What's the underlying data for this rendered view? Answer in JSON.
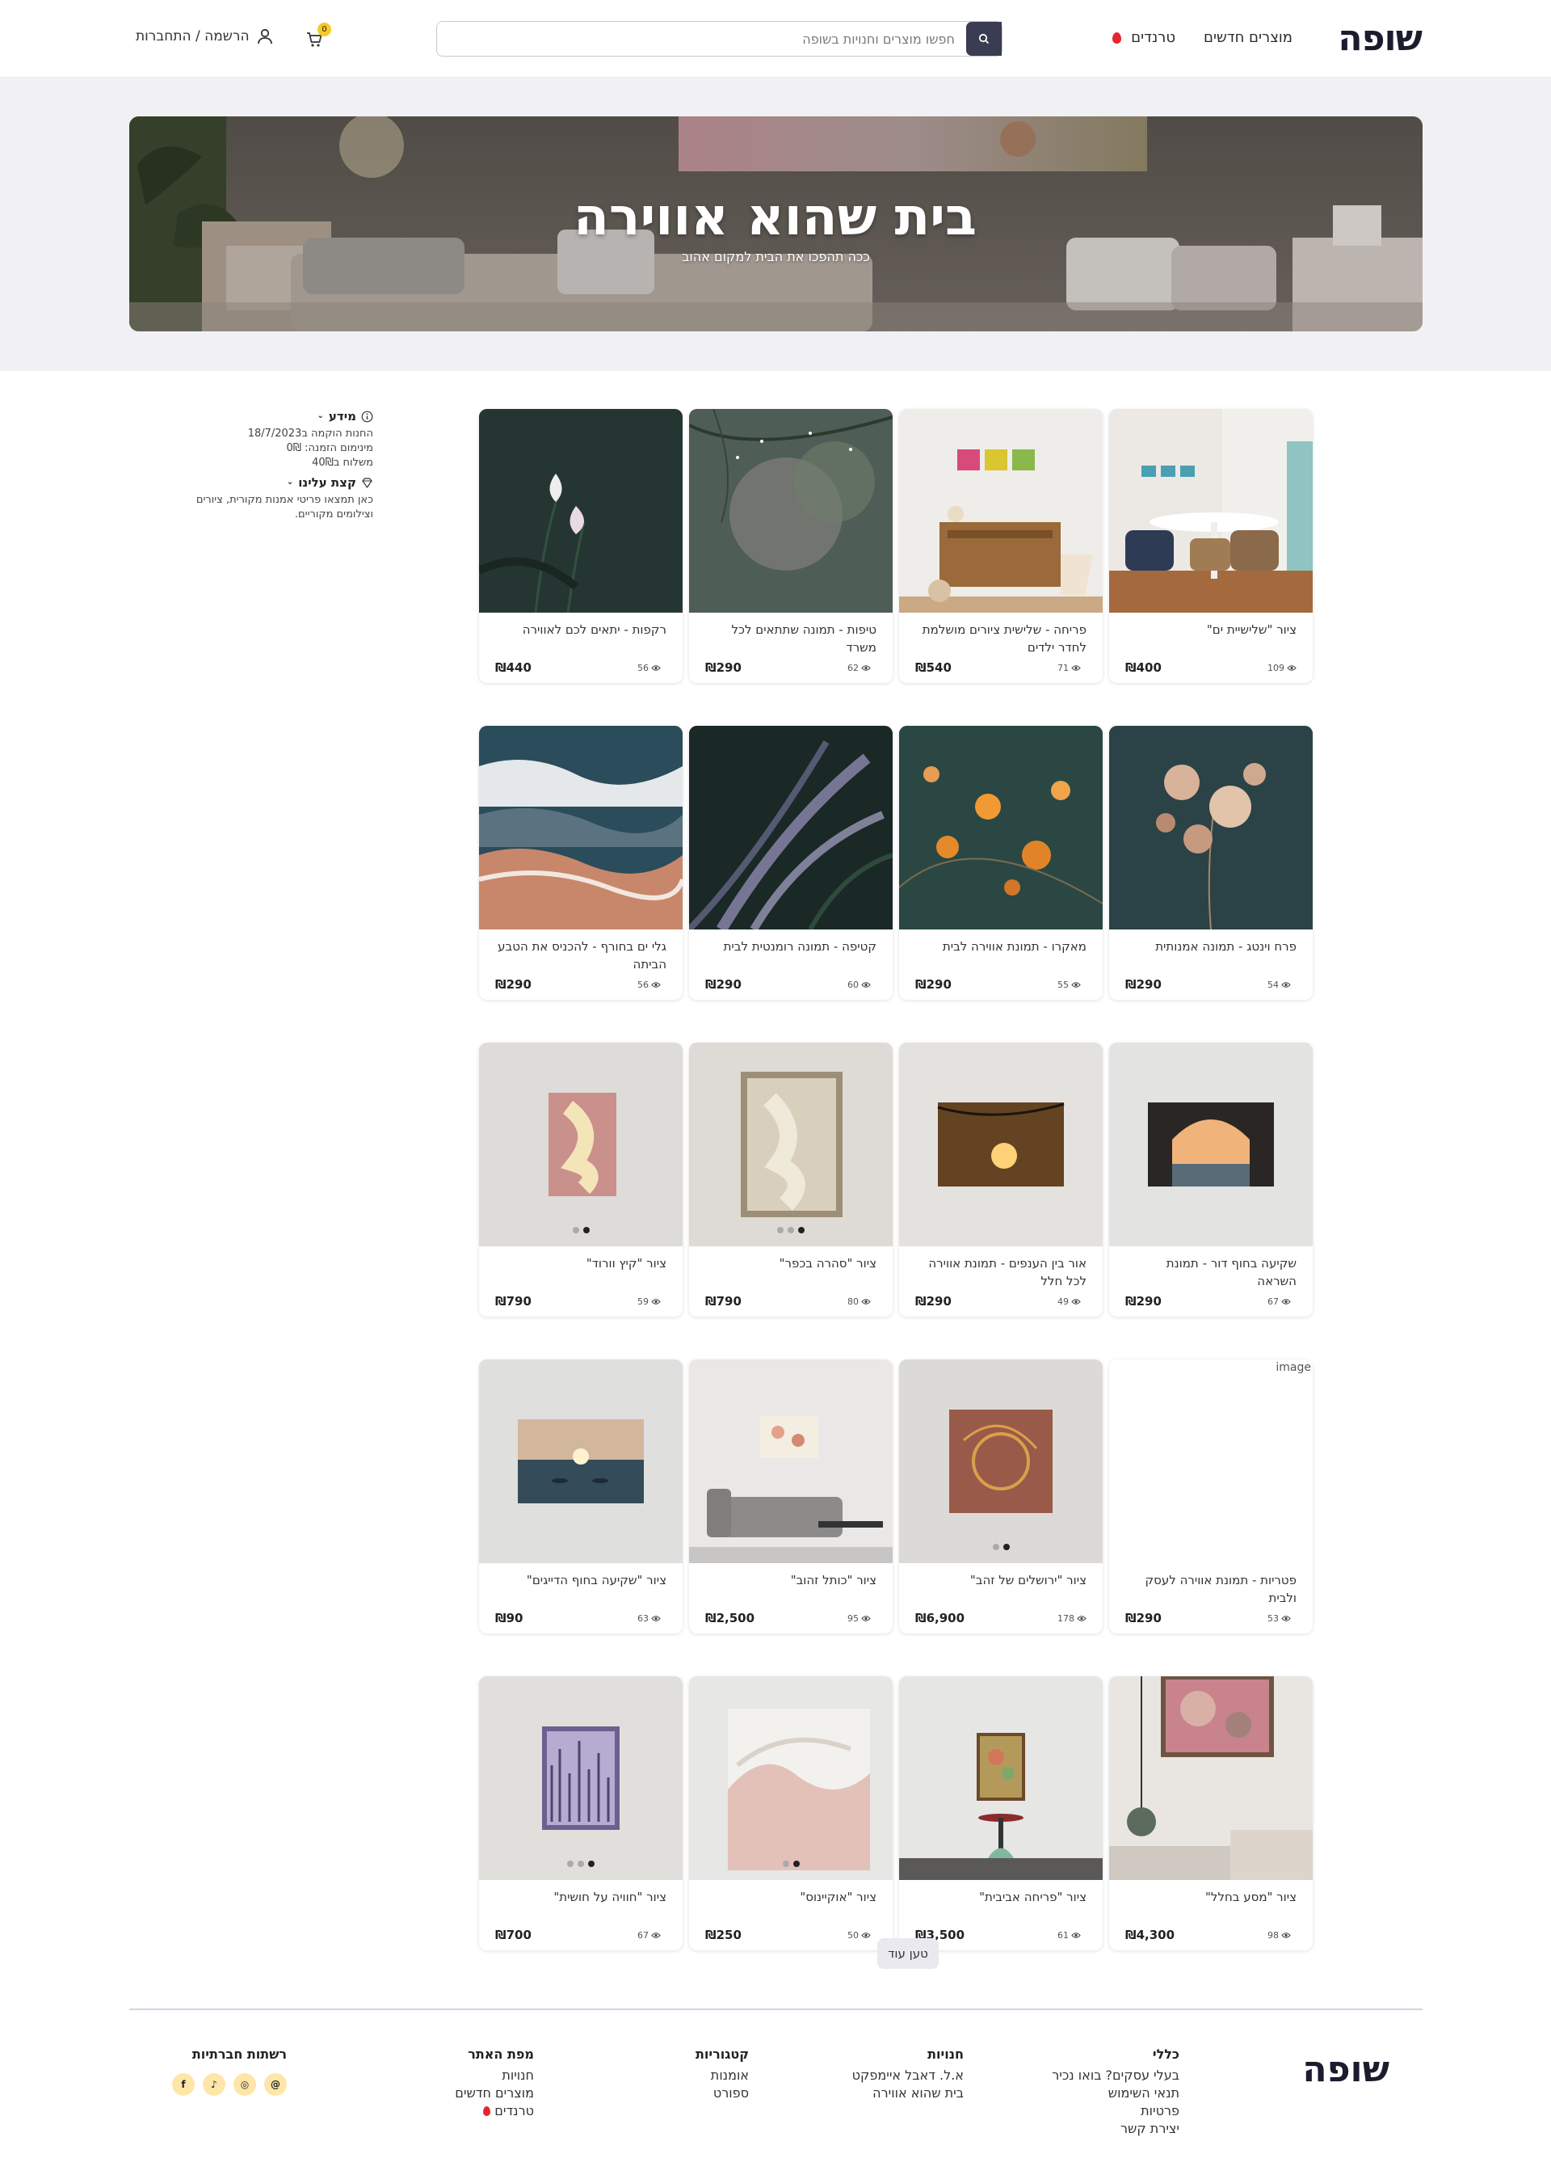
{
  "header": {
    "logo": "שופה",
    "nav": {
      "new_products": "מוצרים חדשים",
      "trends": "טרנדים"
    },
    "search_placeholder": "חפשו מוצרים וחנויות בשופה",
    "cart_count": "0",
    "login": "הרשמה / התחברות"
  },
  "hero": {
    "title": "בית שהוא אווירה",
    "subtitle": "ככה תהפכו את הבית למקום אהוב"
  },
  "sidebar": {
    "info_title": "מידע",
    "info_lines": [
      "החנות הוקמה ב18/7/2023",
      "מינימום הזמנה: 0₪",
      "משלוח ב40₪"
    ],
    "about_title": "קצת עלינו",
    "about_text": "כאן תמצאו פריטי אמנות מקורית, ציורים וצילומים מקוריים."
  },
  "products": [
    {
      "title": "ציור \"שלישיית ים\"",
      "price": "₪400",
      "views": "109",
      "img": "dining"
    },
    {
      "title": "פריחה - שלישית ציורים מושלמת לחדר ילדים",
      "price": "₪540",
      "views": "71",
      "img": "kids"
    },
    {
      "title": "טיפות - תמונה שתתאים לכל משרד",
      "price": "₪290",
      "views": "62",
      "img": "drops"
    },
    {
      "title": "רקפות - יתאים לכם לאווירה",
      "price": "₪440",
      "views": "56",
      "img": "cyclamen"
    },
    {
      "title": "פרח וינטג - תמונה אמנותית",
      "price": "₪290",
      "views": "54",
      "img": "vintage"
    },
    {
      "title": "מאקרו - תמונת אווירה לבית",
      "price": "₪290",
      "views": "55",
      "img": "macro"
    },
    {
      "title": "קטיפה - תמונה רומנטית לבית",
      "price": "₪290",
      "views": "60",
      "img": "velvet"
    },
    {
      "title": "גלי ים בחורף - להכניס את הטבע הביתה",
      "price": "₪290",
      "views": "56",
      "img": "waves"
    },
    {
      "title": "שקיעה בחוף דור - תמונת השראה",
      "price": "₪290",
      "views": "67",
      "img": "arch"
    },
    {
      "title": "אור בין הענפים - תמונת אווירה לכל חלל",
      "price": "₪290",
      "views": "49",
      "img": "branches"
    },
    {
      "title": "ציור \"סהרה בכפר\"",
      "price": "₪790",
      "views": "80",
      "img": "sahara",
      "dots": 3
    },
    {
      "title": "ציור \"קיץ וורוד\"",
      "price": "₪790",
      "views": "59",
      "img": "pinksummer",
      "dots": 2
    },
    {
      "title": "פטריות - תמונת אווירה לעסק ולבית",
      "price": "₪290",
      "views": "53",
      "img": "broken",
      "alt": "image"
    },
    {
      "title": "ציור \"ירושלים של זהב\"",
      "price": "₪6,900",
      "views": "178",
      "img": "jerusalem",
      "dots": 2
    },
    {
      "title": "ציור \"כותל זהוב\"",
      "price": "₪2,500",
      "views": "95",
      "img": "sofa"
    },
    {
      "title": "ציור \"שקיעה בחוף הדייגים\"",
      "price": "₪90",
      "views": "63",
      "img": "fishermen"
    },
    {
      "title": "ציור \"מסע בחלל\"",
      "price": "₪4,300",
      "views": "98",
      "img": "space"
    },
    {
      "title": "ציור \"פריחה אביבית\"",
      "price": "₪3,500",
      "views": "61",
      "img": "spring"
    },
    {
      "title": "ציור \"אוקיינוס\"",
      "price": "₪250",
      "views": "50",
      "img": "ocean",
      "dots": 2
    },
    {
      "title": "ציור \"חוויה על חושית\"",
      "price": "₪700",
      "views": "67",
      "img": "sensory",
      "dots": 3
    }
  ],
  "load_more": "טען עוד",
  "footer": {
    "logo": "שופה",
    "general": {
      "title": "כללי",
      "links": [
        "בעלי עסקים? בואו נכיר",
        "תנאי השימוש",
        "פרטיות",
        "יצירת קשר"
      ]
    },
    "stores": {
      "title": "חנויות",
      "links": [
        "א.ל. דאבל איימפקט",
        "בית שהוא אווירה"
      ]
    },
    "categories": {
      "title": "קטגוריות",
      "links": [
        "אומנות",
        "ספורט"
      ]
    },
    "sitemap": {
      "title": "מפת האתר",
      "links": [
        "חנויות",
        "מוצרים חדשים",
        "טרנדים"
      ]
    },
    "social": {
      "title": "רשתות חברתיות",
      "icons": [
        "facebook-icon",
        "tiktok-icon",
        "instagram-icon",
        "threads-icon"
      ]
    }
  }
}
